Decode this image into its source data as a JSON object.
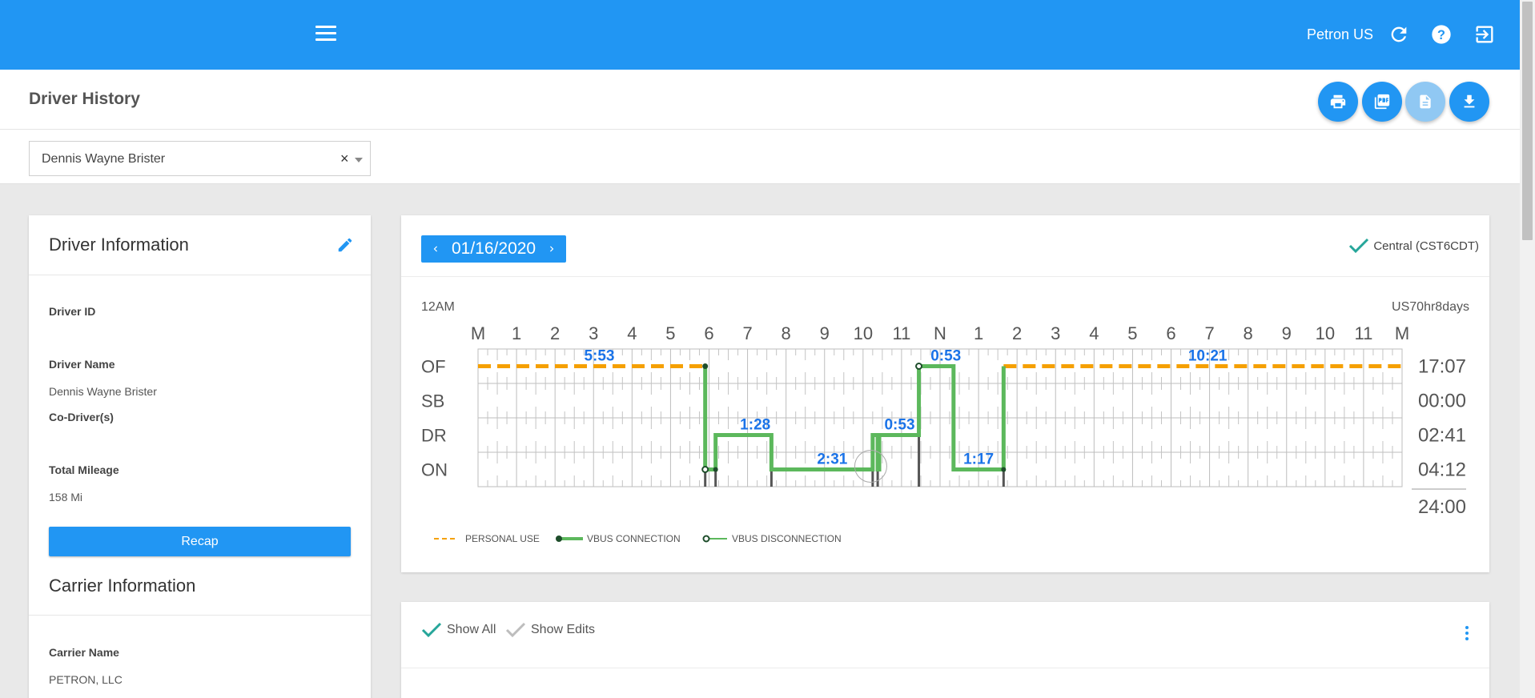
{
  "topbar": {
    "company": "Petron US",
    "icons": [
      "refresh-icon",
      "help-icon",
      "logout-icon"
    ]
  },
  "header": {
    "title": "Driver History",
    "actions": [
      "print-icon",
      "pdf-icon",
      "document-icon",
      "download-icon"
    ]
  },
  "selector": {
    "value": "Dennis Wayne Brister",
    "clear": "×"
  },
  "driver_info": {
    "title": "Driver Information",
    "driver_id_label": "Driver ID",
    "driver_id_value": "",
    "driver_name_label": "Driver Name",
    "driver_name_value": "Dennis Wayne Brister",
    "codriver_label": "Co-Driver(s)",
    "mileage_label": "Total Mileage",
    "mileage_value": "158 Mi",
    "recap_label": "Recap"
  },
  "carrier_info": {
    "title": "Carrier Information",
    "carrier_name_label": "Carrier Name",
    "carrier_name_value": "PETRON, LLC"
  },
  "log_chart": {
    "date": "01/16/2020",
    "timezone": "Central (CST6CDT)",
    "start_label": "12AM",
    "ruleset": "US70hr8days",
    "hour_labels": [
      "M",
      "1",
      "2",
      "3",
      "4",
      "5",
      "6",
      "7",
      "8",
      "9",
      "10",
      "11",
      "N",
      "1",
      "2",
      "3",
      "4",
      "5",
      "6",
      "7",
      "8",
      "9",
      "10",
      "11",
      "M"
    ],
    "status_rows": [
      "OF",
      "SB",
      "DR",
      "ON"
    ],
    "totals": [
      "17:07",
      "00:00",
      "02:41",
      "04:12"
    ],
    "grand_total": "24:00",
    "personal_use": [
      [
        0,
        5.9
      ],
      [
        13.65,
        24
      ]
    ],
    "duty_path": [
      [
        5.9,
        "OF"
      ],
      [
        5.9,
        "ON"
      ],
      [
        6.17,
        "ON"
      ],
      [
        6.17,
        "DR"
      ],
      [
        7.62,
        "DR"
      ],
      [
        7.62,
        "ON"
      ],
      [
        10.25,
        "ON"
      ],
      [
        10.25,
        "DR"
      ],
      [
        10.38,
        "DR"
      ],
      [
        10.38,
        "ON"
      ],
      [
        10.42,
        "ON"
      ],
      [
        10.42,
        "DR"
      ],
      [
        11.45,
        "DR"
      ],
      [
        11.45,
        "OF"
      ],
      [
        12.35,
        "OF"
      ],
      [
        12.35,
        "ON"
      ],
      [
        13.65,
        "ON"
      ],
      [
        13.65,
        "OF"
      ]
    ],
    "duration_labels": [
      {
        "text": "5:53",
        "hour": 3.15,
        "row": "OF"
      },
      {
        "text": "0:53",
        "hour": 12.15,
        "row": "OF"
      },
      {
        "text": "10:21",
        "hour": 18.95,
        "row": "OF"
      },
      {
        "text": "1:28",
        "hour": 7.2,
        "row": "DR"
      },
      {
        "text": "0:53",
        "hour": 10.95,
        "row": "DR"
      },
      {
        "text": "2:31",
        "hour": 9.2,
        "row": "ON"
      },
      {
        "text": "1:17",
        "hour": 13.0,
        "row": "ON"
      }
    ],
    "legend": [
      "PERSONAL USE",
      "VBUS CONNECTION",
      "VBUS DISCONNECTION"
    ]
  },
  "events": {
    "show_all": "Show All",
    "show_edits": "Show Edits"
  },
  "colors": {
    "brand": "#2196f3",
    "personal_use": "#f5a000",
    "duty_line": "#5cb85c",
    "label_blue": "#1a73e8"
  }
}
